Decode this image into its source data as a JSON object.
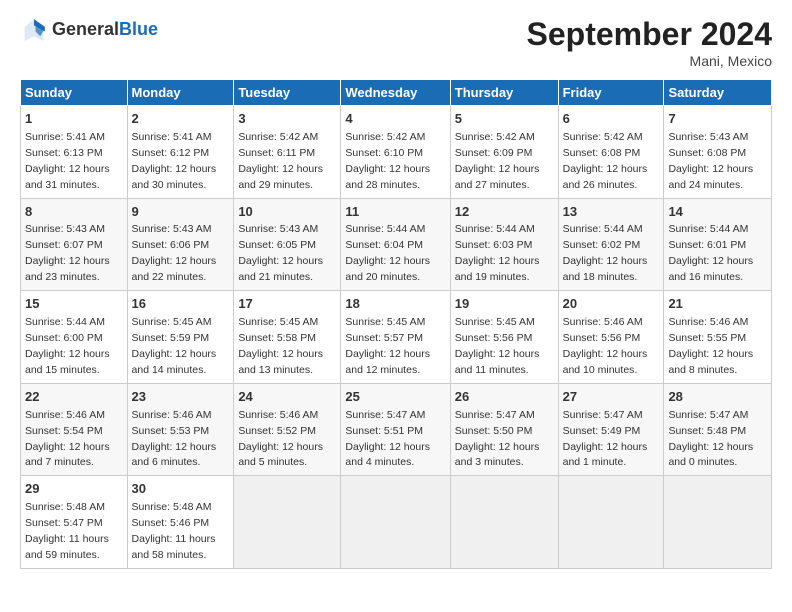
{
  "header": {
    "logo_general": "General",
    "logo_blue": "Blue",
    "month_title": "September 2024",
    "location": "Mani, Mexico"
  },
  "days_of_week": [
    "Sunday",
    "Monday",
    "Tuesday",
    "Wednesday",
    "Thursday",
    "Friday",
    "Saturday"
  ],
  "weeks": [
    [
      {
        "day": 1,
        "detail": "Sunrise: 5:41 AM\nSunset: 6:13 PM\nDaylight: 12 hours\nand 31 minutes."
      },
      {
        "day": 2,
        "detail": "Sunrise: 5:41 AM\nSunset: 6:12 PM\nDaylight: 12 hours\nand 30 minutes."
      },
      {
        "day": 3,
        "detail": "Sunrise: 5:42 AM\nSunset: 6:11 PM\nDaylight: 12 hours\nand 29 minutes."
      },
      {
        "day": 4,
        "detail": "Sunrise: 5:42 AM\nSunset: 6:10 PM\nDaylight: 12 hours\nand 28 minutes."
      },
      {
        "day": 5,
        "detail": "Sunrise: 5:42 AM\nSunset: 6:09 PM\nDaylight: 12 hours\nand 27 minutes."
      },
      {
        "day": 6,
        "detail": "Sunrise: 5:42 AM\nSunset: 6:08 PM\nDaylight: 12 hours\nand 26 minutes."
      },
      {
        "day": 7,
        "detail": "Sunrise: 5:43 AM\nSunset: 6:08 PM\nDaylight: 12 hours\nand 24 minutes."
      }
    ],
    [
      {
        "day": 8,
        "detail": "Sunrise: 5:43 AM\nSunset: 6:07 PM\nDaylight: 12 hours\nand 23 minutes."
      },
      {
        "day": 9,
        "detail": "Sunrise: 5:43 AM\nSunset: 6:06 PM\nDaylight: 12 hours\nand 22 minutes."
      },
      {
        "day": 10,
        "detail": "Sunrise: 5:43 AM\nSunset: 6:05 PM\nDaylight: 12 hours\nand 21 minutes."
      },
      {
        "day": 11,
        "detail": "Sunrise: 5:44 AM\nSunset: 6:04 PM\nDaylight: 12 hours\nand 20 minutes."
      },
      {
        "day": 12,
        "detail": "Sunrise: 5:44 AM\nSunset: 6:03 PM\nDaylight: 12 hours\nand 19 minutes."
      },
      {
        "day": 13,
        "detail": "Sunrise: 5:44 AM\nSunset: 6:02 PM\nDaylight: 12 hours\nand 18 minutes."
      },
      {
        "day": 14,
        "detail": "Sunrise: 5:44 AM\nSunset: 6:01 PM\nDaylight: 12 hours\nand 16 minutes."
      }
    ],
    [
      {
        "day": 15,
        "detail": "Sunrise: 5:44 AM\nSunset: 6:00 PM\nDaylight: 12 hours\nand 15 minutes."
      },
      {
        "day": 16,
        "detail": "Sunrise: 5:45 AM\nSunset: 5:59 PM\nDaylight: 12 hours\nand 14 minutes."
      },
      {
        "day": 17,
        "detail": "Sunrise: 5:45 AM\nSunset: 5:58 PM\nDaylight: 12 hours\nand 13 minutes."
      },
      {
        "day": 18,
        "detail": "Sunrise: 5:45 AM\nSunset: 5:57 PM\nDaylight: 12 hours\nand 12 minutes."
      },
      {
        "day": 19,
        "detail": "Sunrise: 5:45 AM\nSunset: 5:56 PM\nDaylight: 12 hours\nand 11 minutes."
      },
      {
        "day": 20,
        "detail": "Sunrise: 5:46 AM\nSunset: 5:56 PM\nDaylight: 12 hours\nand 10 minutes."
      },
      {
        "day": 21,
        "detail": "Sunrise: 5:46 AM\nSunset: 5:55 PM\nDaylight: 12 hours\nand 8 minutes."
      }
    ],
    [
      {
        "day": 22,
        "detail": "Sunrise: 5:46 AM\nSunset: 5:54 PM\nDaylight: 12 hours\nand 7 minutes."
      },
      {
        "day": 23,
        "detail": "Sunrise: 5:46 AM\nSunset: 5:53 PM\nDaylight: 12 hours\nand 6 minutes."
      },
      {
        "day": 24,
        "detail": "Sunrise: 5:46 AM\nSunset: 5:52 PM\nDaylight: 12 hours\nand 5 minutes."
      },
      {
        "day": 25,
        "detail": "Sunrise: 5:47 AM\nSunset: 5:51 PM\nDaylight: 12 hours\nand 4 minutes."
      },
      {
        "day": 26,
        "detail": "Sunrise: 5:47 AM\nSunset: 5:50 PM\nDaylight: 12 hours\nand 3 minutes."
      },
      {
        "day": 27,
        "detail": "Sunrise: 5:47 AM\nSunset: 5:49 PM\nDaylight: 12 hours\nand 1 minute."
      },
      {
        "day": 28,
        "detail": "Sunrise: 5:47 AM\nSunset: 5:48 PM\nDaylight: 12 hours\nand 0 minutes."
      }
    ],
    [
      {
        "day": 29,
        "detail": "Sunrise: 5:48 AM\nSunset: 5:47 PM\nDaylight: 11 hours\nand 59 minutes."
      },
      {
        "day": 30,
        "detail": "Sunrise: 5:48 AM\nSunset: 5:46 PM\nDaylight: 11 hours\nand 58 minutes."
      },
      null,
      null,
      null,
      null,
      null
    ]
  ]
}
